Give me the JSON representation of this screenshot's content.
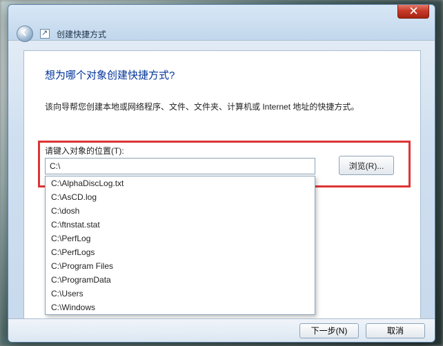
{
  "window": {
    "title": "创建快捷方式"
  },
  "wizard": {
    "heading": "想为哪个对象创建快捷方式?",
    "description": "该向导帮您创建本地或网络程序、文件、文件夹、计算机或 Internet 地址的快捷方式。",
    "location_label": "请键入对象的位置(T):",
    "location_value": "C:\\",
    "browse_label": "浏览(R)..."
  },
  "autocomplete": {
    "items": [
      "C:\\AlphaDiscLog.txt",
      "C:\\AsCD.log",
      "C:\\dosh",
      "C:\\ftnstat.stat",
      "C:\\PerfLog",
      "C:\\PerfLogs",
      "C:\\Program Files",
      "C:\\ProgramData",
      "C:\\Users",
      "C:\\Windows"
    ]
  },
  "footer": {
    "next": "下一步(N)",
    "cancel": "取消"
  }
}
